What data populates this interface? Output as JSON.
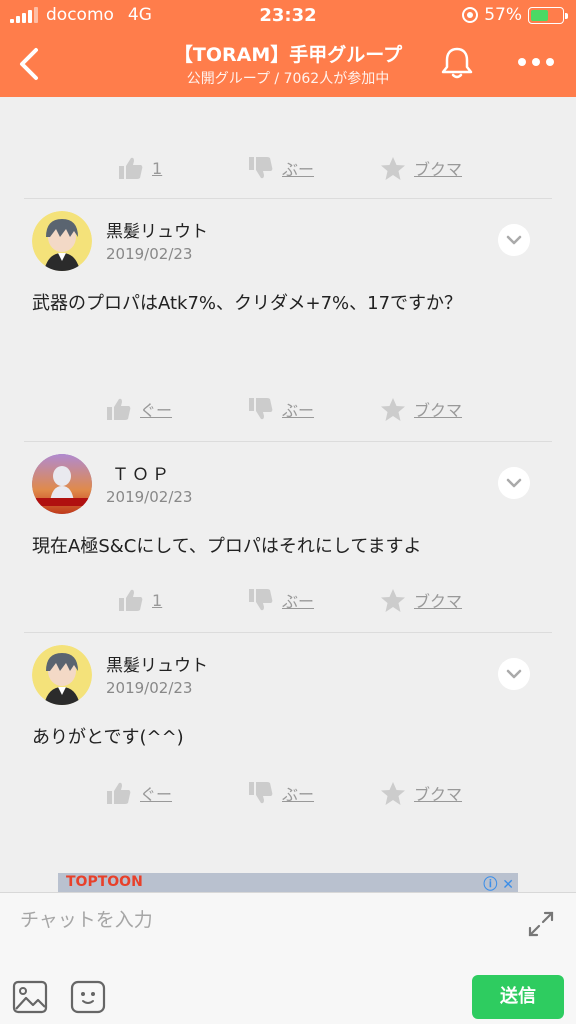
{
  "status_bar": {
    "carrier": "docomo",
    "network": "4G",
    "time": "23:32",
    "battery": "57%",
    "battery_level": 0.57
  },
  "header": {
    "title": "【TORAM】手甲グループ",
    "subtitle": "公開グループ / 7062人が参加中",
    "bg_color": "#ff7d4b"
  },
  "top_actions": {
    "like": "1",
    "dislike": "ぶー",
    "bookmark": "ブクマ"
  },
  "posts": [
    {
      "username": "黒髪リュウト",
      "date": "2019/02/23",
      "text": "武器のプロパはAtk7%、クリダメ+7%、17ですか？",
      "like": "ぐー",
      "dislike": "ぶー",
      "bookmark": "ブクマ"
    },
    {
      "username": "ＴＯＰ",
      "date": "2019/02/23",
      "text": "現在A極S&Cにして、プロパはそれにしてますよ",
      "like": "1",
      "dislike": "ぶー",
      "bookmark": "ブクマ"
    },
    {
      "username": "黒髪リュウト",
      "date": "2019/02/23",
      "text": "ありがとです(^^)",
      "like": "ぐー",
      "dislike": "ぶー",
      "bookmark": "ブクマ"
    }
  ],
  "ad": {
    "brand": "TOPTOON"
  },
  "chat": {
    "placeholder": "チャットを入力",
    "send_label": "送信",
    "send_color": "#2ecc60"
  }
}
